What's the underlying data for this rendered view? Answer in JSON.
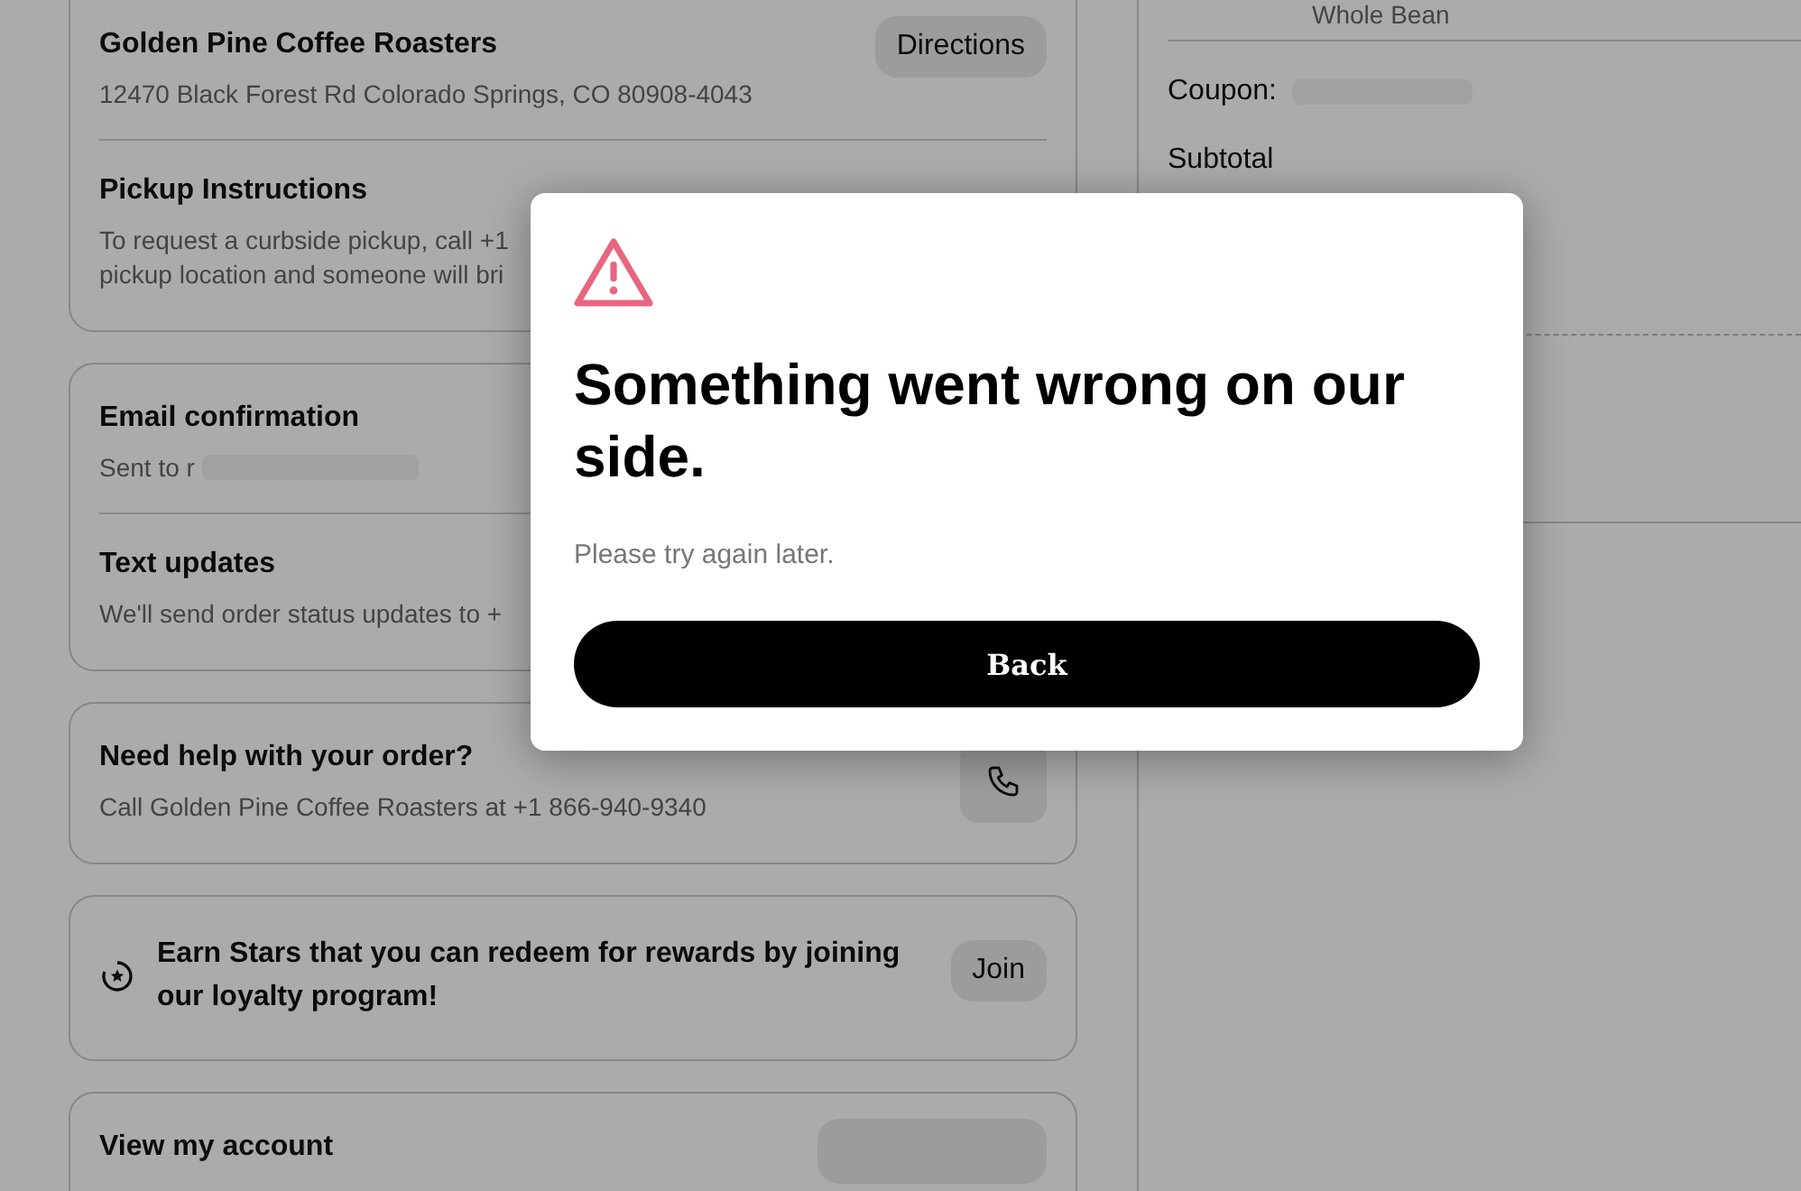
{
  "order_summary": {
    "item_option": "Whole Bean",
    "coupon_label": "Coupon:",
    "subtotal_label": "Subtotal"
  },
  "store": {
    "name": "Golden Pine Coffee Roasters",
    "address": "12470 Black Forest Rd Colorado Springs, CO 80908-4043",
    "directions_button": "Directions",
    "pickup_title": "Pickup Instructions",
    "pickup_lines": [
      "To request a curbside pickup, call +1",
      "pickup location and someone will bri"
    ]
  },
  "notifications": [
    {
      "title": "Email confirmation",
      "detail": "Sent to r",
      "redacted": true
    },
    {
      "title": "Text updates",
      "detail": "We'll send order status updates to +",
      "redacted": false
    }
  ],
  "help": {
    "title": "Need help with your order?",
    "detail": "Call Golden Pine Coffee Roasters at +1 866-940-9340"
  },
  "rewards": {
    "text": "Earn Stars that you can redeem for rewards by joining our loyalty program!",
    "button": "Join"
  },
  "account": {
    "title": "View my account"
  },
  "dialog": {
    "title": "Something went wrong on our side.",
    "message": "Please try again later.",
    "button": "Back"
  }
}
